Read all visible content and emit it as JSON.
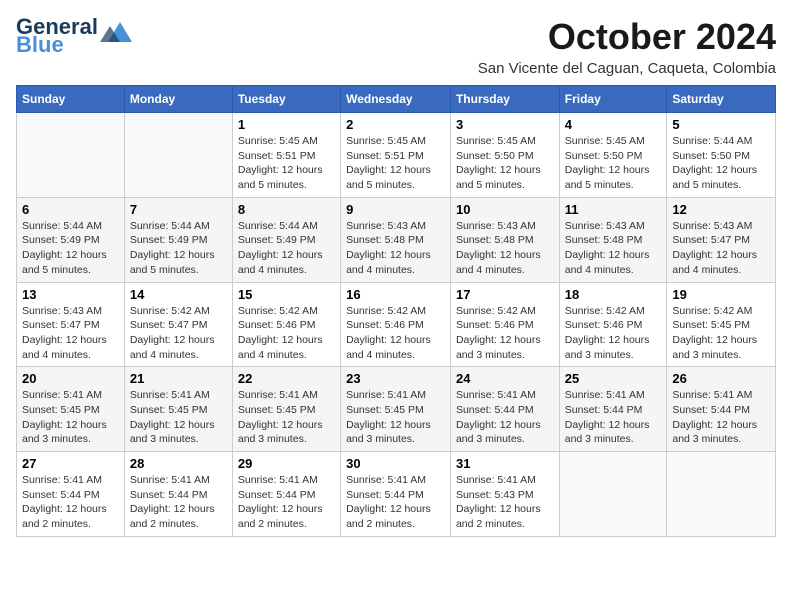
{
  "header": {
    "logo_line1": "General",
    "logo_line2": "Blue",
    "month": "October 2024",
    "location": "San Vicente del Caguan, Caqueta, Colombia"
  },
  "weekdays": [
    "Sunday",
    "Monday",
    "Tuesday",
    "Wednesday",
    "Thursday",
    "Friday",
    "Saturday"
  ],
  "weeks": [
    [
      {
        "day": "",
        "info": ""
      },
      {
        "day": "",
        "info": ""
      },
      {
        "day": "1",
        "info": "Sunrise: 5:45 AM\nSunset: 5:51 PM\nDaylight: 12 hours\nand 5 minutes."
      },
      {
        "day": "2",
        "info": "Sunrise: 5:45 AM\nSunset: 5:51 PM\nDaylight: 12 hours\nand 5 minutes."
      },
      {
        "day": "3",
        "info": "Sunrise: 5:45 AM\nSunset: 5:50 PM\nDaylight: 12 hours\nand 5 minutes."
      },
      {
        "day": "4",
        "info": "Sunrise: 5:45 AM\nSunset: 5:50 PM\nDaylight: 12 hours\nand 5 minutes."
      },
      {
        "day": "5",
        "info": "Sunrise: 5:44 AM\nSunset: 5:50 PM\nDaylight: 12 hours\nand 5 minutes."
      }
    ],
    [
      {
        "day": "6",
        "info": "Sunrise: 5:44 AM\nSunset: 5:49 PM\nDaylight: 12 hours\nand 5 minutes."
      },
      {
        "day": "7",
        "info": "Sunrise: 5:44 AM\nSunset: 5:49 PM\nDaylight: 12 hours\nand 5 minutes."
      },
      {
        "day": "8",
        "info": "Sunrise: 5:44 AM\nSunset: 5:49 PM\nDaylight: 12 hours\nand 4 minutes."
      },
      {
        "day": "9",
        "info": "Sunrise: 5:43 AM\nSunset: 5:48 PM\nDaylight: 12 hours\nand 4 minutes."
      },
      {
        "day": "10",
        "info": "Sunrise: 5:43 AM\nSunset: 5:48 PM\nDaylight: 12 hours\nand 4 minutes."
      },
      {
        "day": "11",
        "info": "Sunrise: 5:43 AM\nSunset: 5:48 PM\nDaylight: 12 hours\nand 4 minutes."
      },
      {
        "day": "12",
        "info": "Sunrise: 5:43 AM\nSunset: 5:47 PM\nDaylight: 12 hours\nand 4 minutes."
      }
    ],
    [
      {
        "day": "13",
        "info": "Sunrise: 5:43 AM\nSunset: 5:47 PM\nDaylight: 12 hours\nand 4 minutes."
      },
      {
        "day": "14",
        "info": "Sunrise: 5:42 AM\nSunset: 5:47 PM\nDaylight: 12 hours\nand 4 minutes."
      },
      {
        "day": "15",
        "info": "Sunrise: 5:42 AM\nSunset: 5:46 PM\nDaylight: 12 hours\nand 4 minutes."
      },
      {
        "day": "16",
        "info": "Sunrise: 5:42 AM\nSunset: 5:46 PM\nDaylight: 12 hours\nand 4 minutes."
      },
      {
        "day": "17",
        "info": "Sunrise: 5:42 AM\nSunset: 5:46 PM\nDaylight: 12 hours\nand 3 minutes."
      },
      {
        "day": "18",
        "info": "Sunrise: 5:42 AM\nSunset: 5:46 PM\nDaylight: 12 hours\nand 3 minutes."
      },
      {
        "day": "19",
        "info": "Sunrise: 5:42 AM\nSunset: 5:45 PM\nDaylight: 12 hours\nand 3 minutes."
      }
    ],
    [
      {
        "day": "20",
        "info": "Sunrise: 5:41 AM\nSunset: 5:45 PM\nDaylight: 12 hours\nand 3 minutes."
      },
      {
        "day": "21",
        "info": "Sunrise: 5:41 AM\nSunset: 5:45 PM\nDaylight: 12 hours\nand 3 minutes."
      },
      {
        "day": "22",
        "info": "Sunrise: 5:41 AM\nSunset: 5:45 PM\nDaylight: 12 hours\nand 3 minutes."
      },
      {
        "day": "23",
        "info": "Sunrise: 5:41 AM\nSunset: 5:45 PM\nDaylight: 12 hours\nand 3 minutes."
      },
      {
        "day": "24",
        "info": "Sunrise: 5:41 AM\nSunset: 5:44 PM\nDaylight: 12 hours\nand 3 minutes."
      },
      {
        "day": "25",
        "info": "Sunrise: 5:41 AM\nSunset: 5:44 PM\nDaylight: 12 hours\nand 3 minutes."
      },
      {
        "day": "26",
        "info": "Sunrise: 5:41 AM\nSunset: 5:44 PM\nDaylight: 12 hours\nand 3 minutes."
      }
    ],
    [
      {
        "day": "27",
        "info": "Sunrise: 5:41 AM\nSunset: 5:44 PM\nDaylight: 12 hours\nand 2 minutes."
      },
      {
        "day": "28",
        "info": "Sunrise: 5:41 AM\nSunset: 5:44 PM\nDaylight: 12 hours\nand 2 minutes."
      },
      {
        "day": "29",
        "info": "Sunrise: 5:41 AM\nSunset: 5:44 PM\nDaylight: 12 hours\nand 2 minutes."
      },
      {
        "day": "30",
        "info": "Sunrise: 5:41 AM\nSunset: 5:44 PM\nDaylight: 12 hours\nand 2 minutes."
      },
      {
        "day": "31",
        "info": "Sunrise: 5:41 AM\nSunset: 5:43 PM\nDaylight: 12 hours\nand 2 minutes."
      },
      {
        "day": "",
        "info": ""
      },
      {
        "day": "",
        "info": ""
      }
    ]
  ]
}
